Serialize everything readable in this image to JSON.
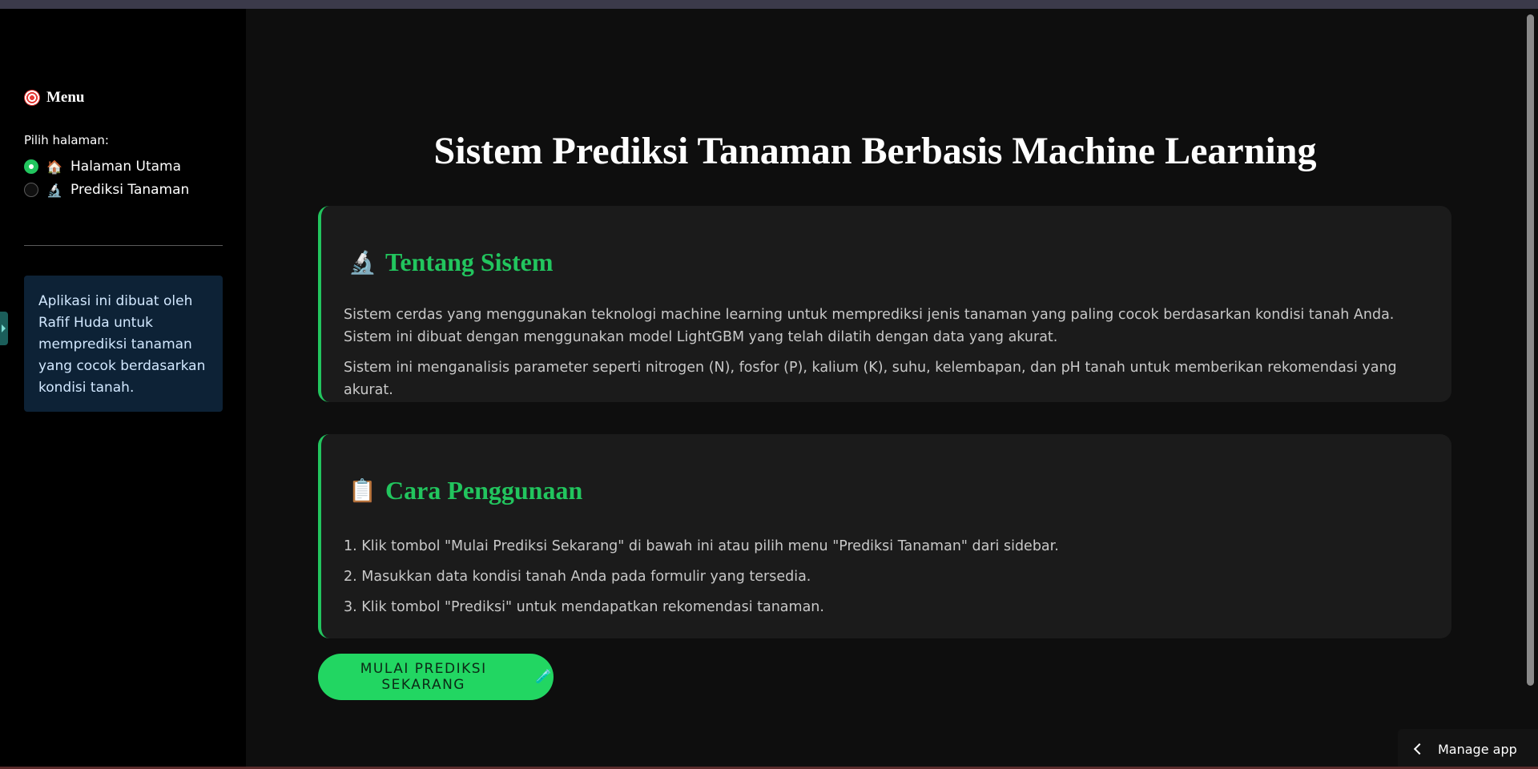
{
  "sidebar": {
    "menu_title": "Menu",
    "menu_icon": "target-icon",
    "pick_label": "Pilih halaman:",
    "options": [
      {
        "icon": "🏠",
        "label": "Halaman Utama",
        "selected": true
      },
      {
        "icon": "🔬",
        "label": "Prediksi Tanaman",
        "selected": false
      }
    ],
    "info": "Aplikasi ini dibuat oleh Rafif Huda untuk memprediksi tanaman yang cocok berdasarkan kondisi tanah."
  },
  "main": {
    "title": "Sistem Prediksi Tanaman Berbasis Machine Learning",
    "about": {
      "icon": "🔬",
      "title": "Tentang Sistem",
      "paragraphs": [
        "Sistem cerdas yang menggunakan teknologi machine learning untuk memprediksi jenis tanaman yang paling cocok berdasarkan kondisi tanah Anda. Sistem ini dibuat dengan menggunakan model LightGBM yang telah dilatih dengan data yang akurat.",
        "Sistem ini menganalisis parameter seperti nitrogen (N), fosfor (P), kalium (K), suhu, kelembapan, dan pH tanah untuk memberikan rekomendasi yang akurat."
      ]
    },
    "usage": {
      "icon": "📋",
      "title": "Cara Penggunaan",
      "steps": [
        "1. Klik tombol \"Mulai Prediksi Sekarang\" di bawah ini atau pilih menu \"Prediksi Tanaman\" dari sidebar.",
        "2. Masukkan data kondisi tanah Anda pada formulir yang tersedia.",
        "3. Klik tombol \"Prediksi\" untuk mendapatkan rekomendasi tanaman."
      ]
    },
    "cta_label": "MULAI PREDIKSI SEKARANG",
    "cta_icon": "🧪"
  },
  "footer": {
    "manage_label": "Manage app"
  },
  "colors": {
    "accent": "#22c55e",
    "sidebar_bg": "#000000",
    "main_bg": "#0e0e0e",
    "card_bg": "#1b1b1b",
    "info_bg": "#0d2236"
  }
}
